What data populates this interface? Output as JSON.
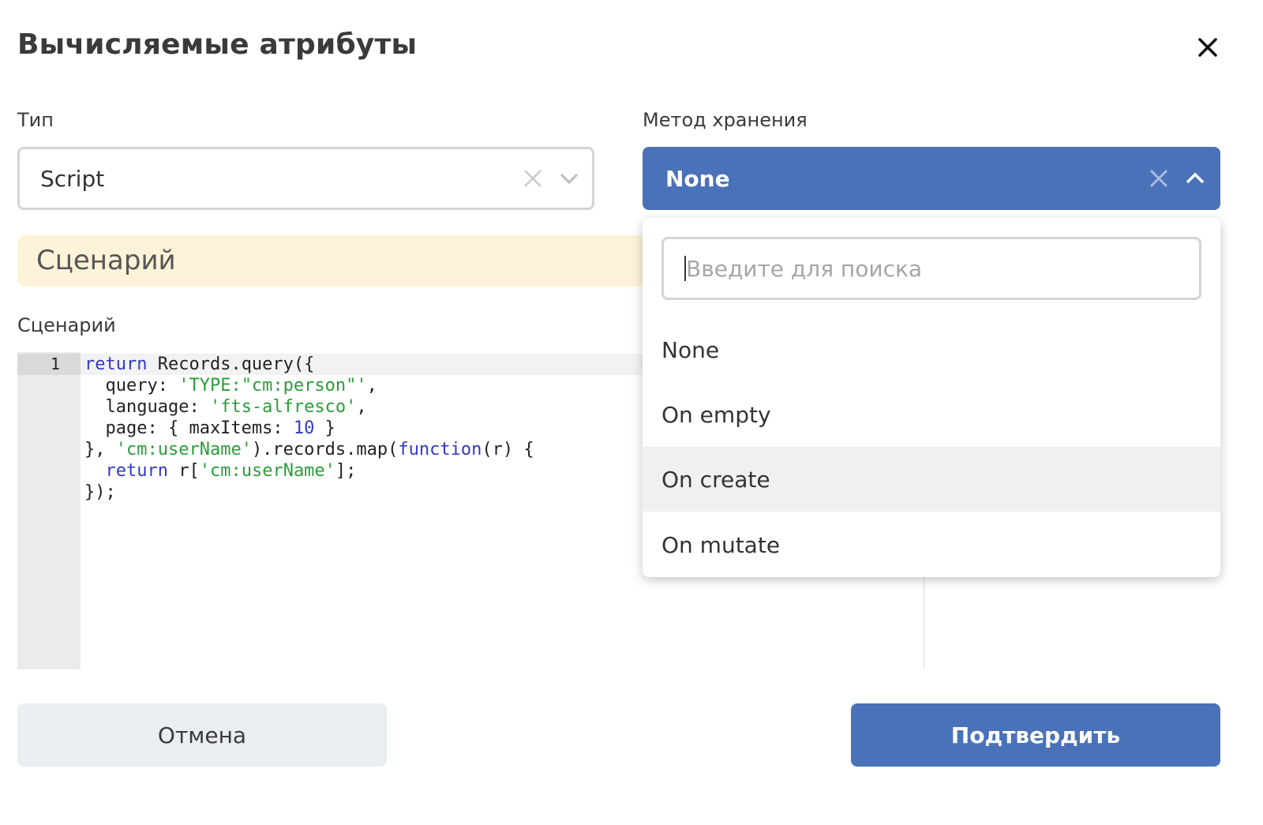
{
  "dialog": {
    "title": "Вычисляемые атрибуты",
    "close_icon": "close-icon"
  },
  "type_field": {
    "label": "Тип",
    "value": "Script",
    "clear_icon": "clear-icon",
    "chevron_icon": "chevron-down-icon"
  },
  "storage_field": {
    "label": "Метод хранения",
    "value": "None",
    "clear_icon": "clear-icon",
    "chevron_icon": "chevron-up-icon",
    "accent_color": "#4a72b8"
  },
  "section": {
    "banner": "Сценарий",
    "editor_label": "Сценарий"
  },
  "editor": {
    "line_number": "1",
    "lines": [
      "return Records.query({",
      "  query: 'TYPE:\"cm:person\"',",
      "  language: 'fts-alfresco',",
      "  page: { maxItems: 10 }",
      "}, 'cm:userName').records.map(function(r) {",
      "  return r['cm:userName'];",
      "});"
    ]
  },
  "dropdown": {
    "search_placeholder": "Введите для поиска",
    "options": [
      "None",
      "On empty",
      "On create",
      "On mutate"
    ],
    "hovered": "On create"
  },
  "footer": {
    "cancel_label": "Отмена",
    "confirm_label": "Подтвердить"
  }
}
